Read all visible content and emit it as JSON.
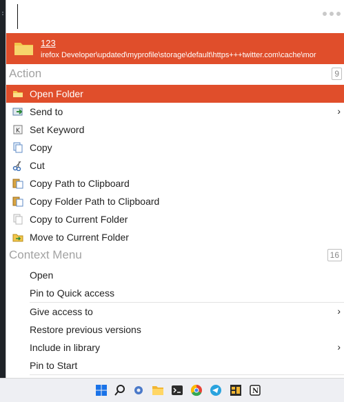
{
  "search": {
    "query": ""
  },
  "result": {
    "title": "123",
    "subtitle": "irefox Developer\\updated\\myprofile\\storage\\default\\https+++twitter.com\\cache\\mor"
  },
  "action_section": {
    "label": "Action",
    "count": "9",
    "items": [
      {
        "label": "Open Folder",
        "icon": "folder-open-icon",
        "selected": true
      },
      {
        "label": "Send to",
        "icon": "send-to-icon",
        "submenu": true
      },
      {
        "label": "Set Keyword",
        "icon": "keyword-icon"
      },
      {
        "label": "Copy",
        "icon": "copy-icon"
      },
      {
        "label": "Cut",
        "icon": "scissors-icon"
      },
      {
        "label": "Copy Path to Clipboard",
        "icon": "clipboard-icon"
      },
      {
        "label": "Copy Folder Path to Clipboard",
        "icon": "clipboard-icon"
      },
      {
        "label": "Copy to Current Folder",
        "icon": "copy-faded-icon"
      },
      {
        "label": "Move to Current Folder",
        "icon": "move-icon"
      }
    ]
  },
  "context_section": {
    "label": "Context Menu",
    "count": "16",
    "items": [
      {
        "label": "Open"
      },
      {
        "label": "Pin to Quick access"
      },
      {
        "label": "Give access to",
        "submenu": true
      },
      {
        "label": "Restore previous versions"
      },
      {
        "label": "Include in library",
        "submenu": true
      },
      {
        "label": "Pin to Start"
      }
    ]
  },
  "taskbar": {
    "icons": [
      "windows-start-icon",
      "search-icon",
      "settings-icon",
      "file-explorer-icon",
      "terminal-icon",
      "chrome-icon",
      "telegram-icon",
      "app-icon",
      "notion-icon"
    ]
  },
  "colors": {
    "accent": "#e04e2b"
  }
}
